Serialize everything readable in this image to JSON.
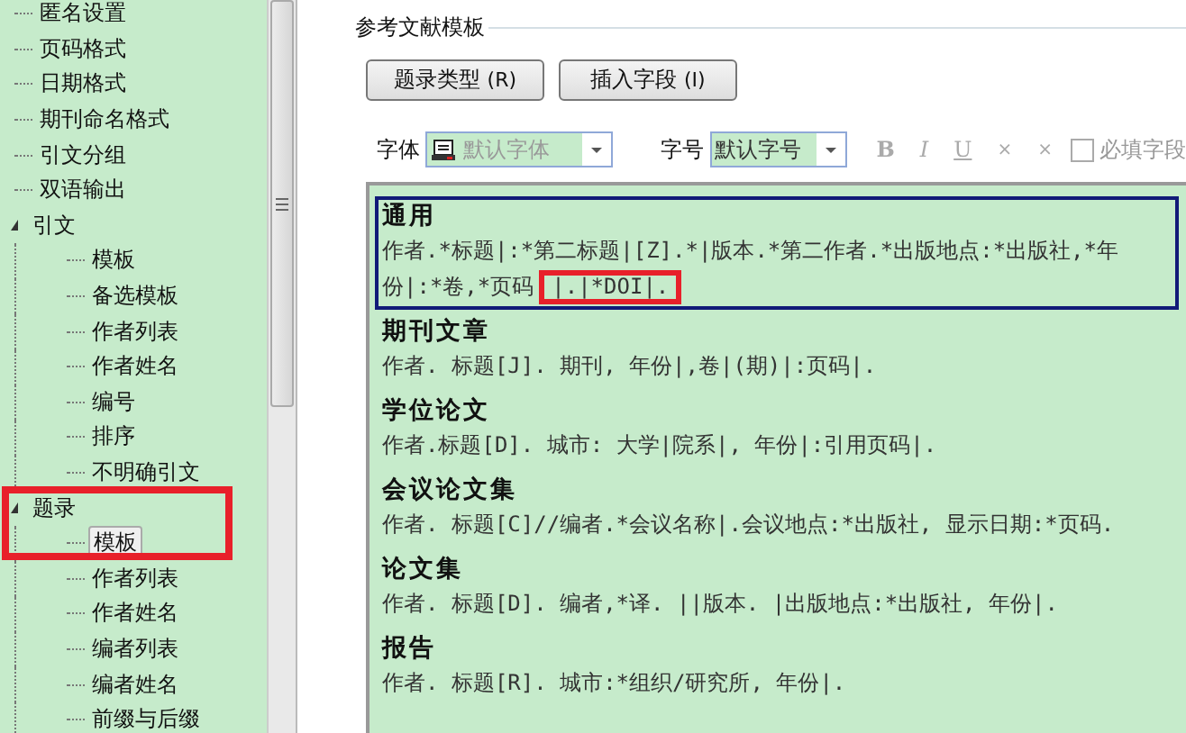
{
  "sidebar": {
    "items": [
      {
        "label": "匿名设置",
        "selected": false
      },
      {
        "label": "页码格式",
        "selected": false
      },
      {
        "label": "日期格式",
        "selected": false
      },
      {
        "label": "期刊命名格式",
        "selected": false
      },
      {
        "label": "引文分组",
        "selected": false
      },
      {
        "label": "双语输出",
        "selected": false
      },
      {
        "label": "引文",
        "selected": false,
        "expanded": true,
        "children": [
          {
            "label": "模板",
            "selected": false
          },
          {
            "label": "备选模板",
            "selected": false
          },
          {
            "label": "作者列表",
            "selected": false
          },
          {
            "label": "作者姓名",
            "selected": false
          },
          {
            "label": "编号",
            "selected": false
          },
          {
            "label": "排序",
            "selected": false
          },
          {
            "label": "不明确引文",
            "selected": false
          }
        ]
      },
      {
        "label": "题录",
        "selected": false,
        "expanded": true,
        "children": [
          {
            "label": "模板",
            "selected": true
          },
          {
            "label": "作者列表",
            "selected": false
          },
          {
            "label": "作者姓名",
            "selected": false
          },
          {
            "label": "编者列表",
            "selected": false
          },
          {
            "label": "编者姓名",
            "selected": false
          },
          {
            "label": "前缀与后缀",
            "selected": false
          }
        ]
      }
    ]
  },
  "panel": {
    "title": "参考文献模板",
    "buttons": [
      {
        "label": "题录类型",
        "key": "(R)"
      },
      {
        "label": "插入字段",
        "key": "(I)"
      }
    ],
    "font": {
      "label": "字体",
      "value": "默认字体"
    },
    "size": {
      "label": "字号",
      "value": "默认字号"
    },
    "format_buttons": [
      {
        "text": "B",
        "kind": "bold"
      },
      {
        "text": "I",
        "kind": "italic"
      },
      {
        "text": "U",
        "kind": "underline"
      },
      {
        "text": "×",
        "kind": "plain"
      },
      {
        "text": "×",
        "kind": "plain"
      }
    ],
    "required": {
      "label": "必填字段",
      "checked": false
    },
    "templates": [
      {
        "title": "通用",
        "body": "作者.*标题|:*第二标题|[Z].*|版本.*第二作者.*出版地点:*出版社,*年份|:*卷,*页码",
        "marked": "|.|*DOI|.",
        "selected": true
      },
      {
        "title": "期刊文章",
        "body": "作者. 标题[J]. 期刊, 年份|,卷|(期)|:页码|.",
        "selected": false
      },
      {
        "title": "学位论文",
        "body": "作者.标题[D]. 城市: 大学|院系|, 年份|:引用页码|.",
        "selected": false
      },
      {
        "title": "会议论文集",
        "body": "作者. 标题[C]//编者.*会议名称|.会议地点:*出版社, 显示日期:*页码.",
        "selected": false
      },
      {
        "title": "论文集",
        "body": "作者. 标题[D]. 编者,*译. ||版本. |出版地点:*出版社, 年份|.",
        "selected": false
      },
      {
        "title": "报告",
        "body": "作者. 标题[R]. 城市:*组织/研究所, 年份|.",
        "selected": false
      }
    ]
  }
}
